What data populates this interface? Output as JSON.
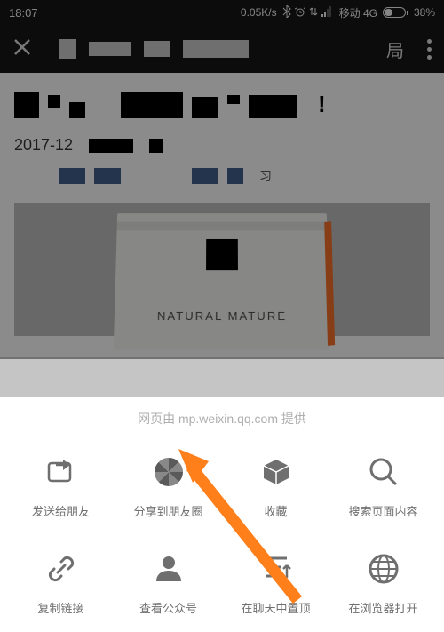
{
  "status_bar": {
    "time": "18:07",
    "speed": "0.05K/s",
    "carrier": "移动 4G",
    "battery_percent": "38%"
  },
  "nav": {
    "right_char": "局"
  },
  "content": {
    "date_prefix": "2017-12",
    "small_char": "习",
    "box_text": "NATURAL MATURE"
  },
  "sheet": {
    "header": "网页由 mp.weixin.qq.com 提供",
    "items": [
      {
        "label": "发送给朋友"
      },
      {
        "label": "分享到朋友圈"
      },
      {
        "label": "收藏"
      },
      {
        "label": "搜索页面内容"
      },
      {
        "label": "复制链接"
      },
      {
        "label": "查看公众号"
      },
      {
        "label": "在聊天中置顶"
      },
      {
        "label": "在浏览器打开"
      }
    ]
  }
}
